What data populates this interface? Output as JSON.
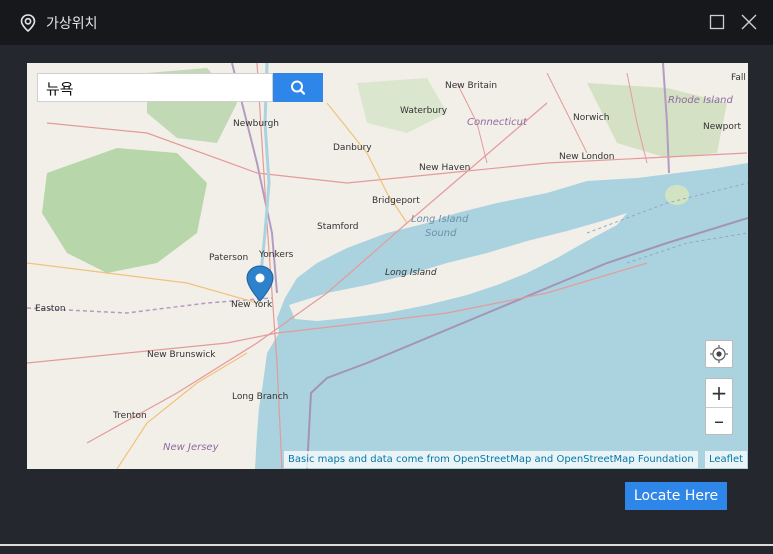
{
  "window": {
    "title": "가상위치",
    "icons": {
      "app": "location-pin-icon",
      "maximize": "maximize-icon",
      "close": "close-icon"
    }
  },
  "search": {
    "value": "뉴욕",
    "button_icon": "search-icon"
  },
  "map": {
    "labels": {
      "new_britain": "New Britain",
      "waterbury": "Waterbury",
      "connecticut": "Connecticut",
      "norwich": "Norwich",
      "rhode_island": "Rhode Island",
      "newport": "Newport",
      "fall": "Fall",
      "newburgh": "Newburgh",
      "danbury": "Danbury",
      "new_haven": "New Haven",
      "new_london": "New London",
      "bridgeport": "Bridgeport",
      "stamford": "Stamford",
      "long_island_sound_1": "Long Island",
      "long_island_sound_2": "Sound",
      "long_island": "Long Island",
      "paterson": "Paterson",
      "yonkers": "Yonkers",
      "new_york": "New York",
      "easton": "Easton",
      "new_brunswick": "New Brunswick",
      "long_branch": "Long Branch",
      "trenton": "Trenton",
      "new_jersey": "New Jersey"
    },
    "marker_icon": "map-marker-icon",
    "controls": {
      "locate_icon": "crosshair-icon",
      "zoom_in": "+",
      "zoom_out": "–"
    },
    "attribution": "Basic maps and data come from OpenStreetMap and OpenStreetMap Foundation",
    "leaflet": "Leaflet"
  },
  "actions": {
    "locate_label": "Locate Here"
  },
  "colors": {
    "accent": "#2d86e8",
    "titlebar": "#17181c",
    "panel": "#25272e",
    "water": "#aad3df",
    "land": "#f2efe9",
    "forest": "#add19e"
  }
}
